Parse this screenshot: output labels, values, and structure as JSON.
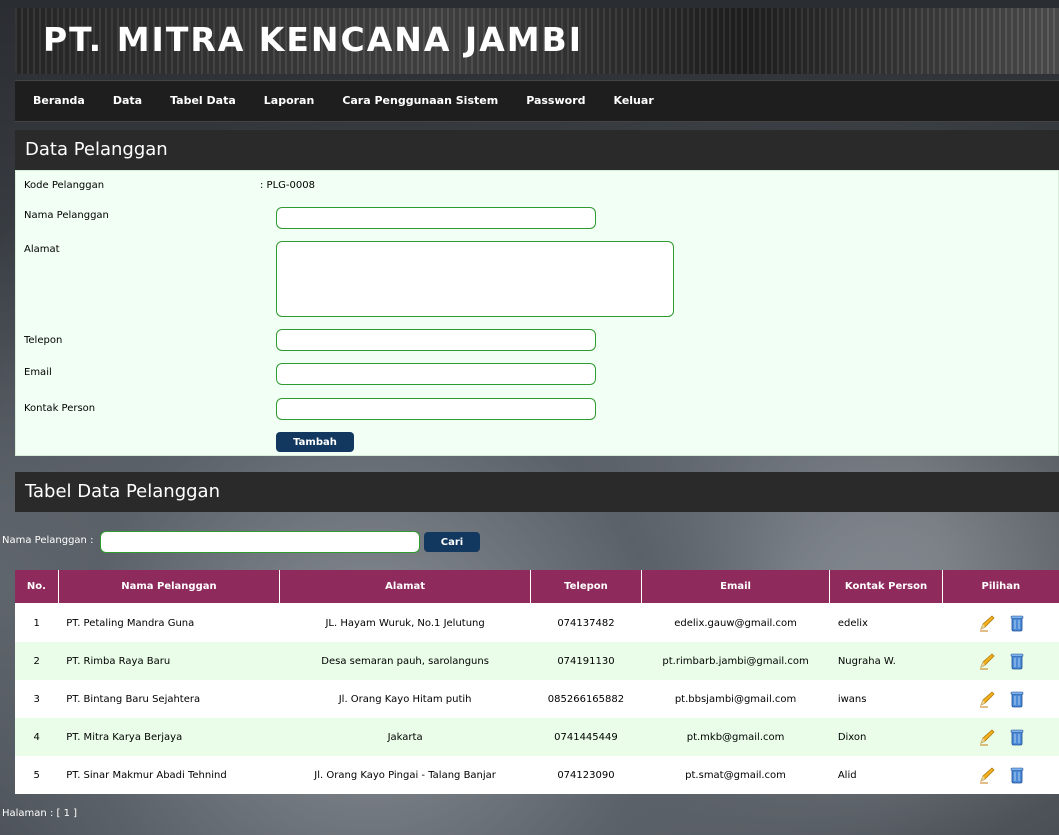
{
  "header": {
    "title": "PT. MITRA KENCANA JAMBI"
  },
  "nav": [
    "Beranda",
    "Data",
    "Tabel Data",
    "Laporan",
    "Cara Penggunaan Sistem",
    "Password",
    "Keluar"
  ],
  "form": {
    "title": "Data Pelanggan",
    "kode_label": "Kode Pelanggan",
    "kode_value": ": PLG-0008",
    "nama_label": "Nama Pelanggan",
    "alamat_label": "Alamat",
    "telepon_label": "Telepon",
    "email_label": "Email",
    "kontak_label": "Kontak Person",
    "submit_label": "Tambah"
  },
  "table_section": {
    "title": "Tabel Data Pelanggan",
    "search_label": "Nama Pelanggan :",
    "search_button": "Cari",
    "columns": [
      "No.",
      "Nama Pelanggan",
      "Alamat",
      "Telepon",
      "Email",
      "Kontak Person",
      "Pilihan"
    ],
    "rows": [
      [
        "1",
        "PT. Petaling Mandra Guna",
        "JL. Hayam Wuruk, No.1 Jelutung",
        "074137482",
        "edelix.gauw@gmail.com",
        "edelix"
      ],
      [
        "2",
        "PT. Rimba Raya Baru",
        "Desa semaran pauh, sarolanguns",
        "074191130",
        "pt.rimbarb.jambi@gmail.com",
        "Nugraha W."
      ],
      [
        "3",
        "PT. Bintang Baru Sejahtera",
        "Jl. Orang Kayo Hitam putih",
        "085266165882",
        "pt.bbsjambi@gmail.com",
        "iwans"
      ],
      [
        "4",
        "PT. Mitra Karya Berjaya",
        "Jakarta",
        "0741445449",
        "pt.mkb@gmail.com",
        "Dixon"
      ],
      [
        "5",
        "PT. Sinar Makmur Abadi Tehnind",
        "Jl. Orang Kayo Pingai - Talang Banjar",
        "074123090",
        "pt.smat@gmail.com",
        "Alid"
      ]
    ]
  },
  "pagination": {
    "text": "Halaman : [ 1 ]"
  },
  "colors": {
    "header_row": "#8e2a5c",
    "button": "#13385f",
    "form_bg": "#f2fff4",
    "row_alt": "#e9fde9"
  },
  "icons": {
    "edit": "pencil-icon",
    "delete": "trash-icon"
  }
}
